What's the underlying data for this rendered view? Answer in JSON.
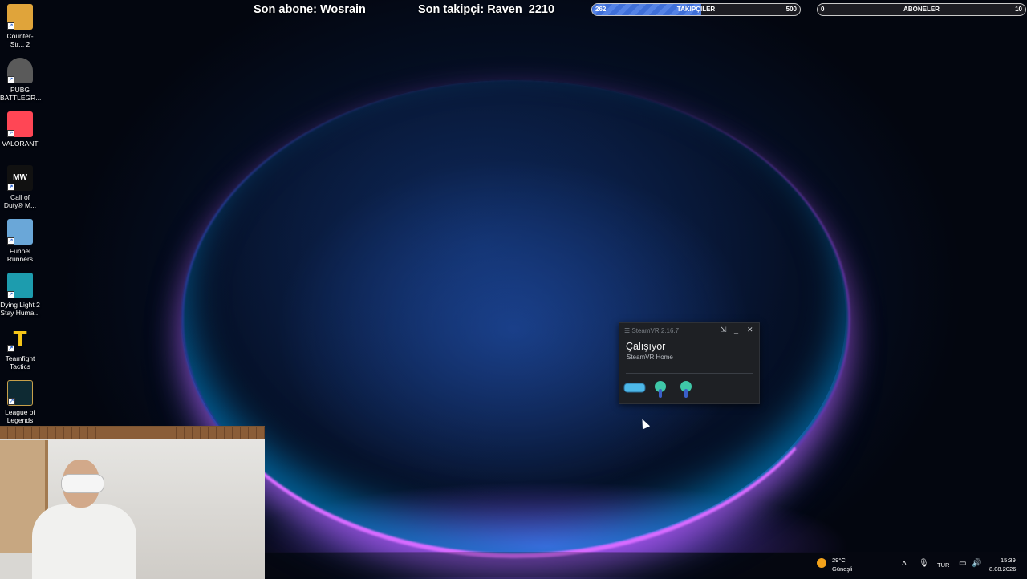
{
  "desktop": {
    "icons": [
      {
        "label": "Counter-Str... 2",
        "icon": "cs2-icon",
        "color": "#e0a43a"
      },
      {
        "label": "PUBG BATTLEGR...",
        "icon": "pubg-helmet-icon",
        "color": "#5a5a5a"
      },
      {
        "label": "VALORANT",
        "icon": "valorant-icon",
        "color": "#ff4655"
      },
      {
        "label": "Call of Duty® M...",
        "icon": "mw-icon",
        "color": "#111111"
      },
      {
        "label": "Funnel Runners",
        "icon": "funnel-runners-icon",
        "color": "#6aa7d8"
      },
      {
        "label": "Dying Light 2 Stay Huma...",
        "icon": "dying-light-icon",
        "color": "#1d9cae"
      },
      {
        "label": "Teamfight Tactics",
        "icon": "tft-icon",
        "color": "#f5c518"
      },
      {
        "label": "League of Legends",
        "icon": "lol-icon",
        "color": "#c8a04a"
      }
    ]
  },
  "overlay": {
    "last_sub": "Son abone: Wosrain",
    "last_follower": "Son takipçi: Raven_2210",
    "followers_goal": {
      "label": "TAKİPÇİLER",
      "current": "262",
      "target": "500",
      "progress": 0.524
    },
    "subs_goal": {
      "label": "ABONELER",
      "current": "0",
      "target": "10",
      "progress": 0.0
    }
  },
  "steamvr": {
    "title": "SteamVR 2.16.7",
    "status": "Çalışıyor",
    "subtitle": "SteamVR Home",
    "devices": [
      "headset-icon",
      "left-controller-icon",
      "right-controller-icon"
    ]
  },
  "taskbar": {
    "weather_temp": "29°C",
    "weather_desc": "Güneşli",
    "lang": "TUR",
    "time": "15:39",
    "date": "8.08.2026"
  },
  "colors": {
    "accent": "#3f6fd8",
    "rim": "#d86bff"
  }
}
